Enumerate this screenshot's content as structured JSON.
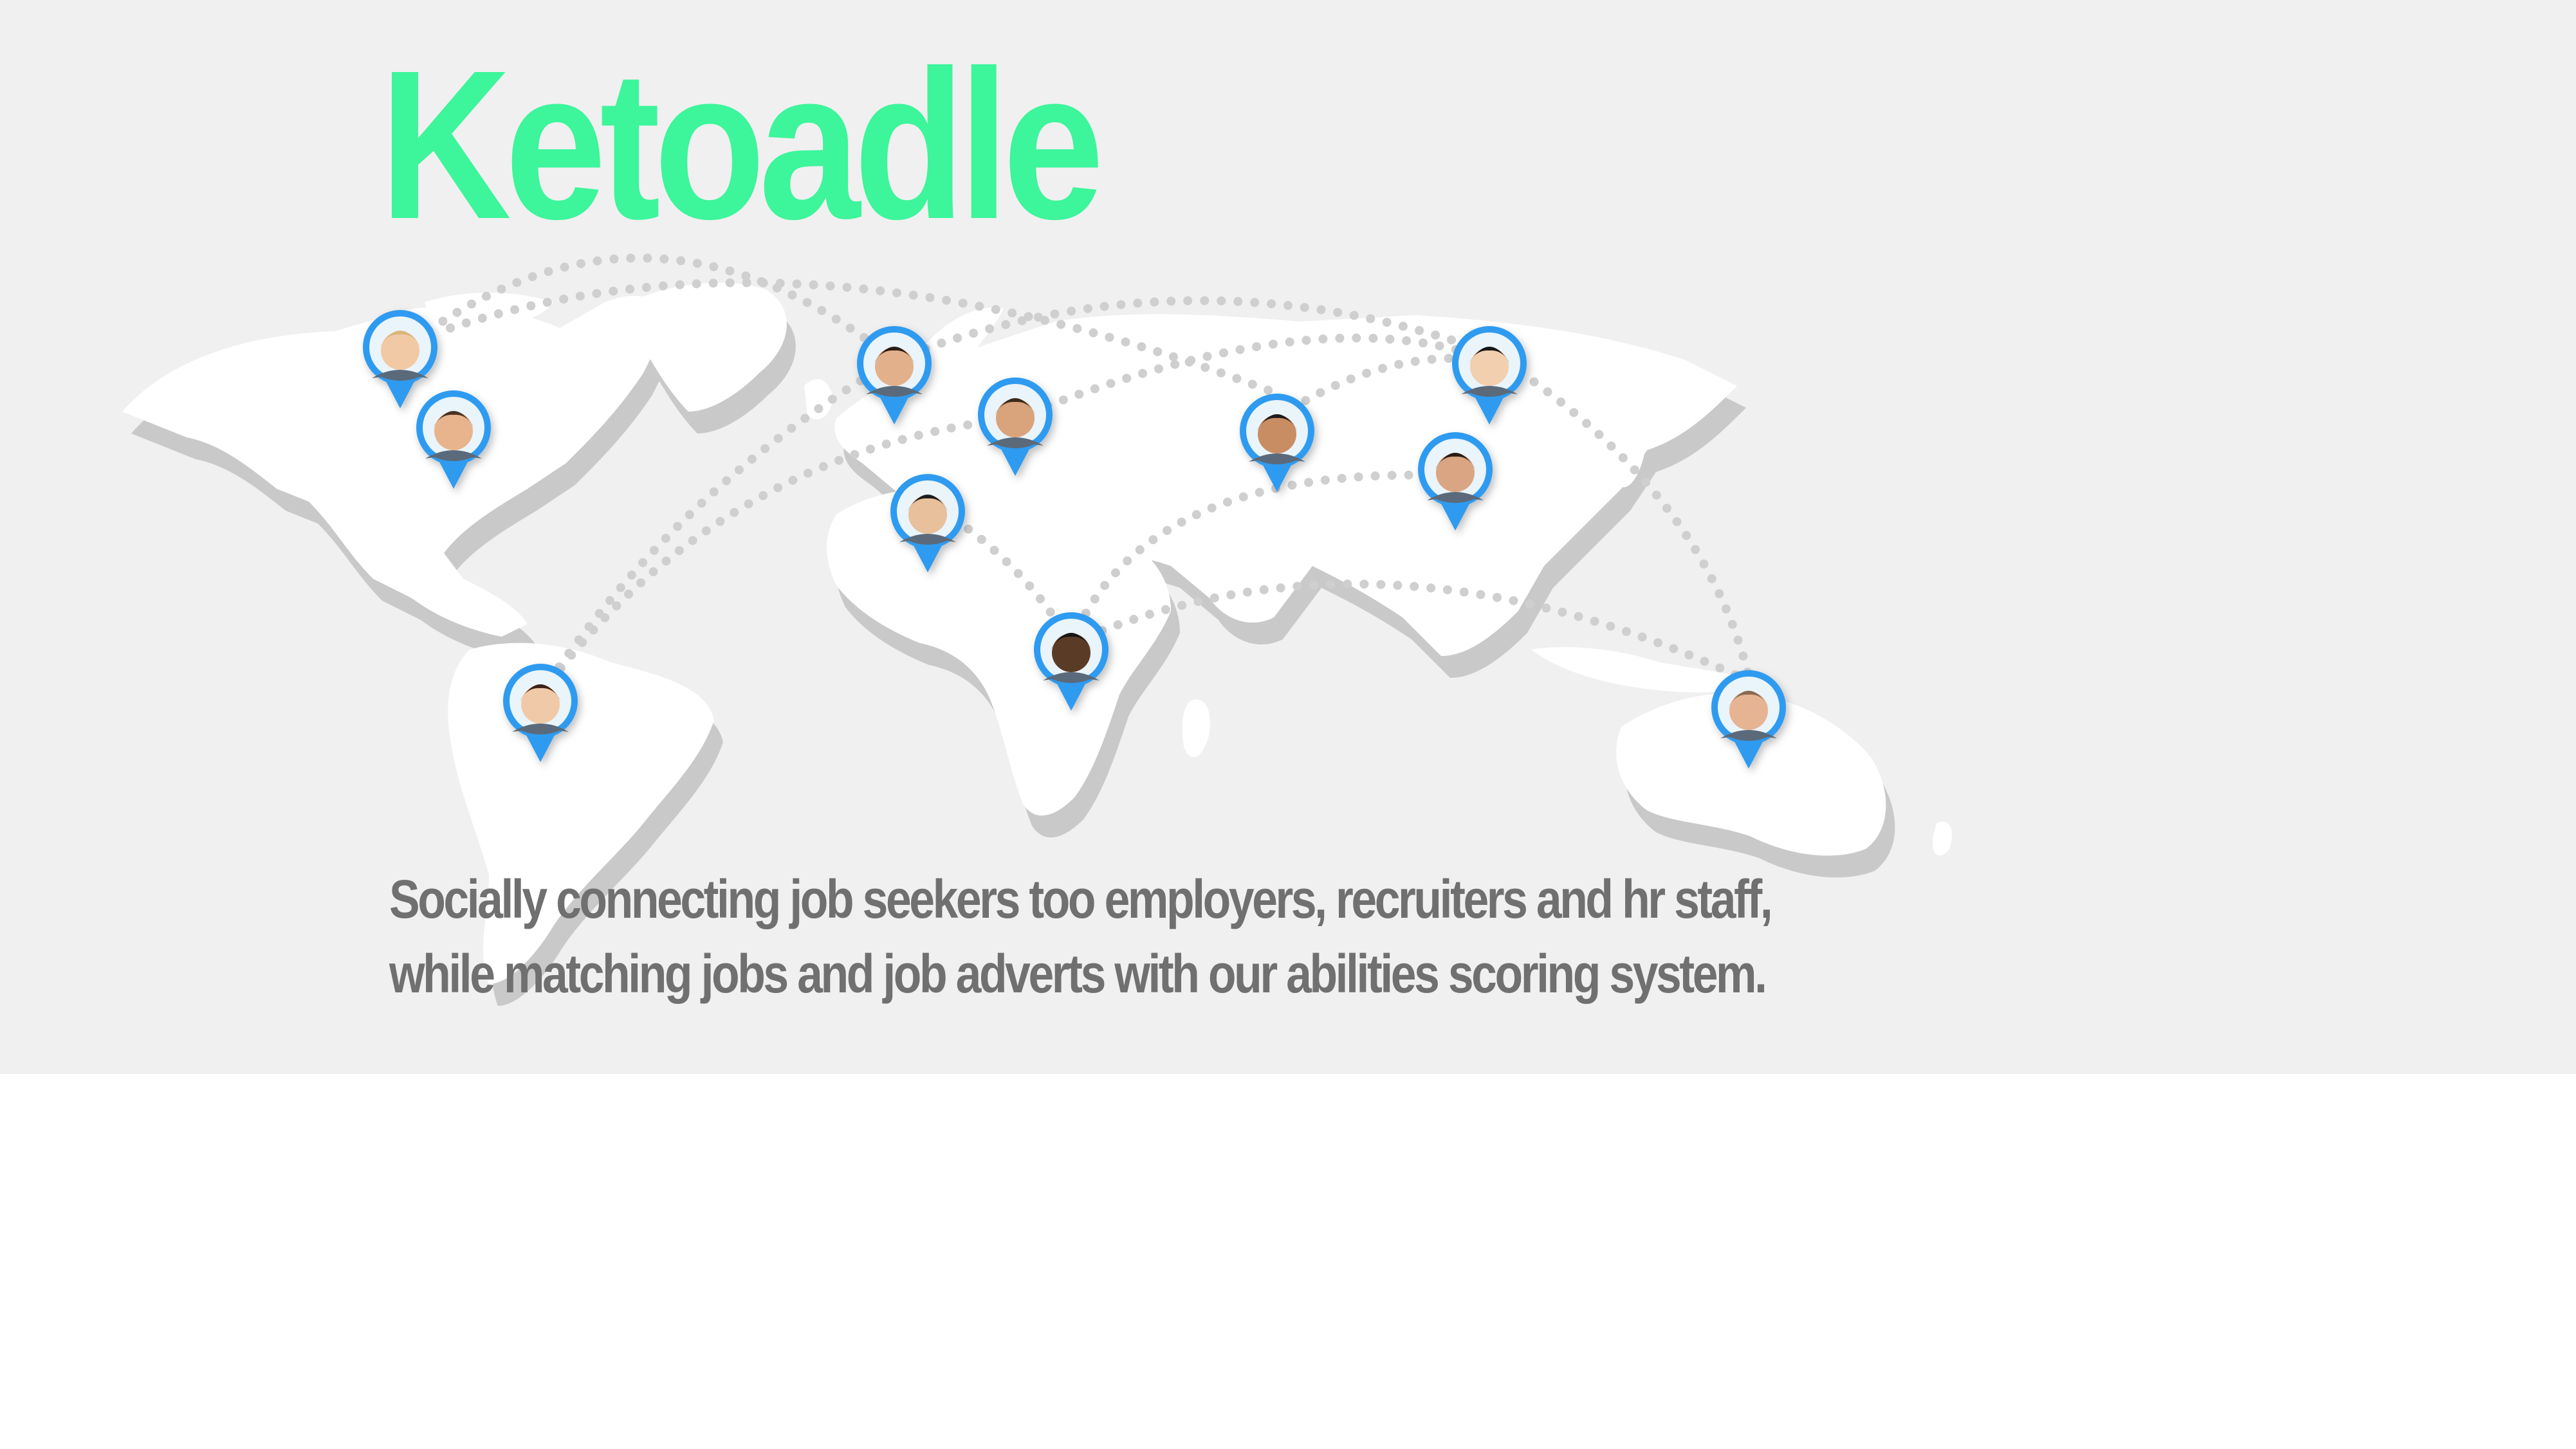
{
  "brand": {
    "title": "Ketoadle",
    "title_color": "#3df59b"
  },
  "tagline": {
    "line1": "Socially connecting job seekers too employers, recruiters and hr staff,",
    "line2": "while matching jobs and job adverts with our abilities scoring system.",
    "color": "#707070"
  },
  "theme": {
    "background": "#f0f0f0",
    "map_land": "#ffffff",
    "map_shadow": "#c9c9c9",
    "connection_dots": "#cfcfcf",
    "pin_color": "#2f9bf0"
  },
  "map": {
    "pins": [
      {
        "name": "north-america-pin-1",
        "skin": "#f1c9a5",
        "hair": "#d9b67a"
      },
      {
        "name": "north-america-pin-2",
        "skin": "#e8b48e",
        "hair": "#4a3020"
      },
      {
        "name": "europe-pin-1",
        "skin": "#e3b08c",
        "hair": "#2b1d14"
      },
      {
        "name": "europe-pin-2",
        "skin": "#d9a37c",
        "hair": "#3a2a1e"
      },
      {
        "name": "north-africa-pin",
        "skin": "#e8c09b",
        "hair": "#1e1e1e"
      },
      {
        "name": "africa-pin",
        "skin": "#5a3a26",
        "hair": "#141414"
      },
      {
        "name": "south-america-pin",
        "skin": "#f0c9a8",
        "hair": "#3a2418"
      },
      {
        "name": "south-asia-pin",
        "skin": "#c98d63",
        "hair": "#1b1b1b"
      },
      {
        "name": "east-asia-pin-1",
        "skin": "#f2cfae",
        "hair": "#121212"
      },
      {
        "name": "east-asia-pin-2",
        "skin": "#d9a582",
        "hair": "#2a1c14"
      },
      {
        "name": "australia-pin",
        "skin": "#e6b493",
        "hair": "#8a6a50"
      }
    ]
  }
}
